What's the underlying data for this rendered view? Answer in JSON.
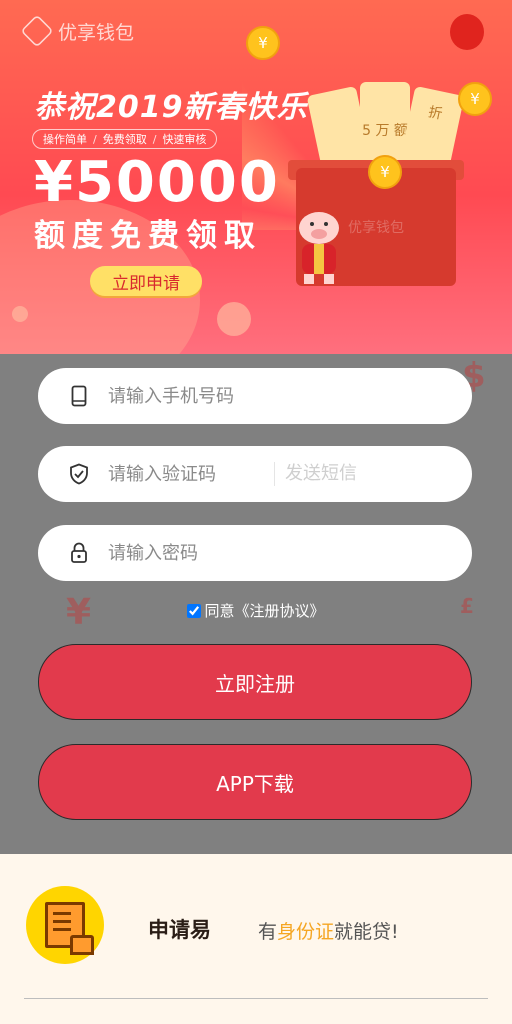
{
  "header": {
    "brand": "优享钱包",
    "greeting": "恭祝2019新春快乐",
    "features": [
      "操作简单",
      "免费领取",
      "快速审核"
    ],
    "amount": "¥50000",
    "amount_subtitle": "额度免费领取",
    "apply_button": "立即申请"
  },
  "illustration": {
    "coupon_text_1": "5 万 额",
    "coupon_text_2": "折",
    "gift_text": "优享钱包",
    "coin_symbol": "¥"
  },
  "form": {
    "phone_placeholder": "请输入手机号码",
    "code_placeholder": "请输入验证码",
    "send_code": "发送短信",
    "password_placeholder": "请输入密码",
    "agree_checked": true,
    "agree_text": "同意《注册协议》",
    "register_button": "立即注册",
    "download_button": "APP下载"
  },
  "feature": {
    "title": "申请易",
    "desc_prefix": "有",
    "desc_highlight": "身份证",
    "desc_suffix": "就能贷!"
  },
  "colors": {
    "primary": "#e23a4c",
    "apply_button": "#ffe066",
    "highlight": "#f5a623",
    "form_bg": "#808080",
    "bottom_bg": "#fff7ec"
  }
}
